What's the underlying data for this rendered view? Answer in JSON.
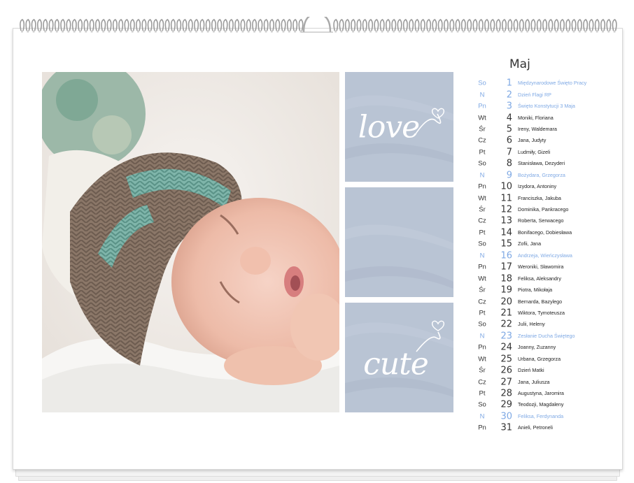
{
  "calendar": {
    "month": "Maj",
    "tiles": [
      {
        "text": "love"
      },
      {
        "text": ""
      },
      {
        "text": "cute"
      }
    ],
    "days": [
      {
        "dow": "So",
        "num": "1",
        "names": "Międzynarodowe Święto Pracy",
        "highlight": true
      },
      {
        "dow": "N",
        "num": "2",
        "names": "Dzień Flagi RP",
        "highlight": true
      },
      {
        "dow": "Pn",
        "num": "3",
        "names": "Święto Konstytucji 3 Maja",
        "highlight": true
      },
      {
        "dow": "Wt",
        "num": "4",
        "names": "Moniki, Floriana",
        "highlight": false
      },
      {
        "dow": "Śr",
        "num": "5",
        "names": "Ireny, Waldemara",
        "highlight": false
      },
      {
        "dow": "Cz",
        "num": "6",
        "names": "Jana, Judyty",
        "highlight": false
      },
      {
        "dow": "Pt",
        "num": "7",
        "names": "Ludmiły, Gizeli",
        "highlight": false
      },
      {
        "dow": "So",
        "num": "8",
        "names": "Stanisława, Dezyderi",
        "highlight": false
      },
      {
        "dow": "N",
        "num": "9",
        "names": "Bożydara, Grzegorza",
        "highlight": true
      },
      {
        "dow": "Pn",
        "num": "10",
        "names": "Izydora, Antoniny",
        "highlight": false
      },
      {
        "dow": "Wt",
        "num": "11",
        "names": "Franciszka, Jakuba",
        "highlight": false
      },
      {
        "dow": "Śr",
        "num": "12",
        "names": "Dominika, Pankracego",
        "highlight": false
      },
      {
        "dow": "Cz",
        "num": "13",
        "names": "Roberta, Serwacego",
        "highlight": false
      },
      {
        "dow": "Pt",
        "num": "14",
        "names": "Bonifacego, Dobiesława",
        "highlight": false
      },
      {
        "dow": "So",
        "num": "15",
        "names": "Zofii, Jana",
        "highlight": false
      },
      {
        "dow": "N",
        "num": "16",
        "names": "Andrzeja, Wieńczysława",
        "highlight": true
      },
      {
        "dow": "Pn",
        "num": "17",
        "names": "Weroniki, Sławomira",
        "highlight": false
      },
      {
        "dow": "Wt",
        "num": "18",
        "names": "Feliksa, Aleksandry",
        "highlight": false
      },
      {
        "dow": "Śr",
        "num": "19",
        "names": "Piotra, Mikołaja",
        "highlight": false
      },
      {
        "dow": "Cz",
        "num": "20",
        "names": "Bernarda, Bazylego",
        "highlight": false
      },
      {
        "dow": "Pt",
        "num": "21",
        "names": "Wiktora, Tymoteusza",
        "highlight": false
      },
      {
        "dow": "So",
        "num": "22",
        "names": "Julii, Heleny",
        "highlight": false
      },
      {
        "dow": "N",
        "num": "23",
        "names": "Zesłanie Ducha Świętego",
        "highlight": true
      },
      {
        "dow": "Pn",
        "num": "24",
        "names": "Joanny, Zuzanny",
        "highlight": false
      },
      {
        "dow": "Wt",
        "num": "25",
        "names": "Urbana, Grzegorza",
        "highlight": false
      },
      {
        "dow": "Śr",
        "num": "26",
        "names": "Dzień Matki",
        "highlight": false
      },
      {
        "dow": "Cz",
        "num": "27",
        "names": "Jana, Juliusza",
        "highlight": false
      },
      {
        "dow": "Pt",
        "num": "28",
        "names": "Augustyna, Jaromira",
        "highlight": false
      },
      {
        "dow": "So",
        "num": "29",
        "names": "Teodozji, Magdaleny",
        "highlight": false
      },
      {
        "dow": "N",
        "num": "30",
        "names": "Feliksa, Ferdynanda",
        "highlight": true
      },
      {
        "dow": "Pn",
        "num": "31",
        "names": "Anieli, Petroneli",
        "highlight": false
      }
    ]
  },
  "colors": {
    "tile": "#b9c4d4",
    "highlight": "#7fa9e4",
    "text": "#333333"
  },
  "icons": {
    "binding": "spiral-binding-icon",
    "hanger": "hanger-hook-icon",
    "heart": "heart-icon"
  }
}
